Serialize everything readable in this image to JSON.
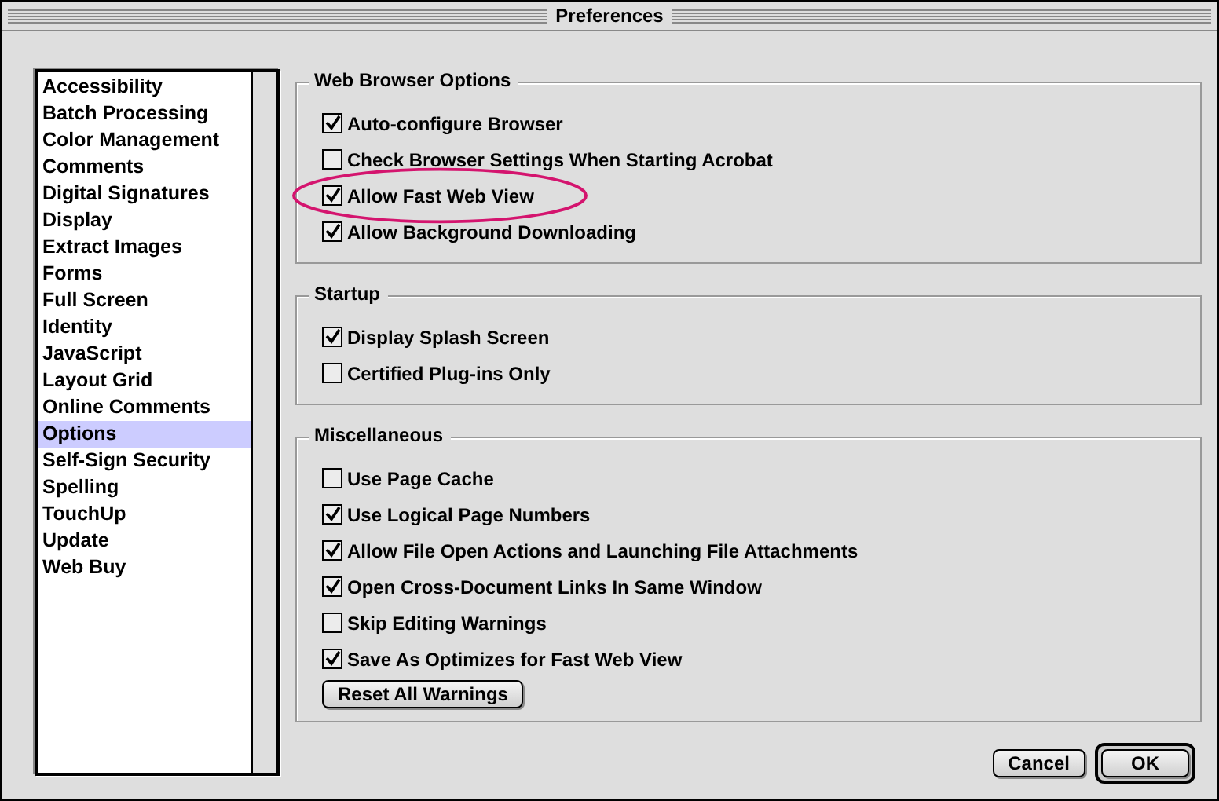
{
  "window": {
    "title": "Preferences"
  },
  "sidebar": {
    "items": [
      {
        "label": "Accessibility",
        "selected": false
      },
      {
        "label": "Batch Processing",
        "selected": false
      },
      {
        "label": "Color Management",
        "selected": false
      },
      {
        "label": "Comments",
        "selected": false
      },
      {
        "label": "Digital Signatures",
        "selected": false
      },
      {
        "label": "Display",
        "selected": false
      },
      {
        "label": "Extract Images",
        "selected": false
      },
      {
        "label": "Forms",
        "selected": false
      },
      {
        "label": "Full Screen",
        "selected": false
      },
      {
        "label": "Identity",
        "selected": false
      },
      {
        "label": "JavaScript",
        "selected": false
      },
      {
        "label": "Layout Grid",
        "selected": false
      },
      {
        "label": "Online Comments",
        "selected": false
      },
      {
        "label": "Options",
        "selected": true
      },
      {
        "label": "Self-Sign Security",
        "selected": false
      },
      {
        "label": "Spelling",
        "selected": false
      },
      {
        "label": "TouchUp",
        "selected": false
      },
      {
        "label": "Update",
        "selected": false
      },
      {
        "label": "Web Buy",
        "selected": false
      }
    ]
  },
  "groups": [
    {
      "title": "Web Browser Options",
      "options": [
        {
          "label": "Auto-configure Browser",
          "checked": true,
          "highlighted": false
        },
        {
          "label": "Check Browser Settings When Starting Acrobat",
          "checked": false,
          "highlighted": false
        },
        {
          "label": "Allow Fast Web View",
          "checked": true,
          "highlighted": true
        },
        {
          "label": "Allow Background Downloading",
          "checked": true,
          "highlighted": false
        }
      ]
    },
    {
      "title": "Startup",
      "options": [
        {
          "label": "Display Splash Screen",
          "checked": true,
          "highlighted": false
        },
        {
          "label": "Certified Plug-ins Only",
          "checked": false,
          "highlighted": false
        }
      ]
    },
    {
      "title": "Miscellaneous",
      "options": [
        {
          "label": "Use Page Cache",
          "checked": false,
          "highlighted": false
        },
        {
          "label": "Use Logical Page Numbers",
          "checked": true,
          "highlighted": false
        },
        {
          "label": "Allow File Open Actions and Launching File Attachments",
          "checked": true,
          "highlighted": false
        },
        {
          "label": "Open Cross-Document Links In Same Window",
          "checked": true,
          "highlighted": false
        },
        {
          "label": "Skip Editing Warnings",
          "checked": false,
          "highlighted": false
        },
        {
          "label": "Save As Optimizes for Fast Web View",
          "checked": true,
          "highlighted": false
        }
      ],
      "button": "Reset All Warnings"
    }
  ],
  "buttons": [
    {
      "label": "Cancel",
      "default": false
    },
    {
      "label": "OK",
      "default": true
    }
  ]
}
